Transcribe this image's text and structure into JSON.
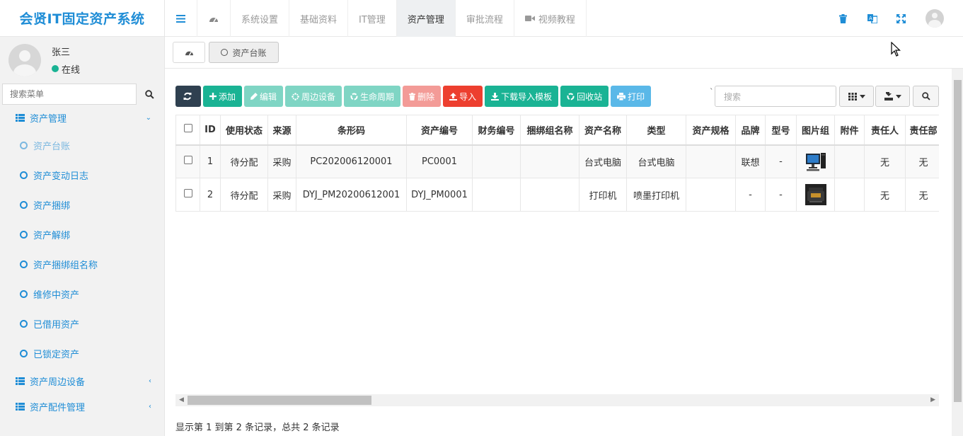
{
  "app": {
    "title": "会贤IT固定资产系统"
  },
  "user": {
    "name": "张三",
    "status": "在线"
  },
  "sidebar": {
    "search_placeholder": "搜索菜单",
    "groups": [
      {
        "label": "资产管理",
        "expanded": true
      },
      {
        "label": "资产周边设备",
        "expanded": false
      },
      {
        "label": "资产配件管理",
        "expanded": false
      }
    ],
    "items": [
      {
        "label": "资产台账",
        "active": true
      },
      {
        "label": "资产变动日志"
      },
      {
        "label": "资产捆绑"
      },
      {
        "label": "资产解绑"
      },
      {
        "label": "资产捆绑组名称"
      },
      {
        "label": "维修中资产"
      },
      {
        "label": "已借用资产"
      },
      {
        "label": "已锁定资产"
      }
    ]
  },
  "topnav": {
    "items": [
      {
        "label": "系统设置"
      },
      {
        "label": "基础资料"
      },
      {
        "label": "IT管理"
      },
      {
        "label": "资产管理",
        "active": true
      },
      {
        "label": "审批流程"
      },
      {
        "label": "视频教程"
      }
    ]
  },
  "tabs": [
    {
      "label": "资产台账",
      "active": true
    }
  ],
  "toolbar": {
    "add": "添加",
    "edit": "编辑",
    "peripheral": "周边设备",
    "lifecycle": "生命周期",
    "delete": "删除",
    "import": "导入",
    "download_template": "下载导入模板",
    "recycle": "回收站",
    "print": "打印",
    "search_placeholder": "搜索"
  },
  "table": {
    "headers": [
      "ID",
      "使用状态",
      "来源",
      "条形码",
      "资产编号",
      "财务编号",
      "捆绑组名称",
      "资产名称",
      "类型",
      "资产规格",
      "品牌",
      "型号",
      "图片组",
      "附件",
      "责任人",
      "责任部"
    ],
    "rows": [
      {
        "id": "1",
        "status": "待分配",
        "source": "采购",
        "barcode": "PC202006120001",
        "asset_no": "PC0001",
        "finance_no": "",
        "bundle": "",
        "name": "台式电脑",
        "type": "台式电脑",
        "spec": "",
        "brand": "联想",
        "model": "-",
        "image": "desktop-computer",
        "attach": "",
        "owner": "无",
        "dept": "无"
      },
      {
        "id": "2",
        "status": "待分配",
        "source": "采购",
        "barcode": "DYJ_PM20200612001",
        "asset_no": "DYJ_PM0001",
        "finance_no": "",
        "bundle": "",
        "name": "打印机",
        "type": "喷墨打印机",
        "spec": "",
        "brand": "-",
        "model": "-",
        "image": "printer",
        "attach": "",
        "owner": "无",
        "dept": "无"
      }
    ]
  },
  "footer": {
    "summary": "显示第 1 到第 2 条记录，总共 2 条记录"
  },
  "colors": {
    "brand": "#1f8dd6",
    "green": "#1ab394",
    "red": "#ed3f2f",
    "dark": "#2f4050"
  }
}
